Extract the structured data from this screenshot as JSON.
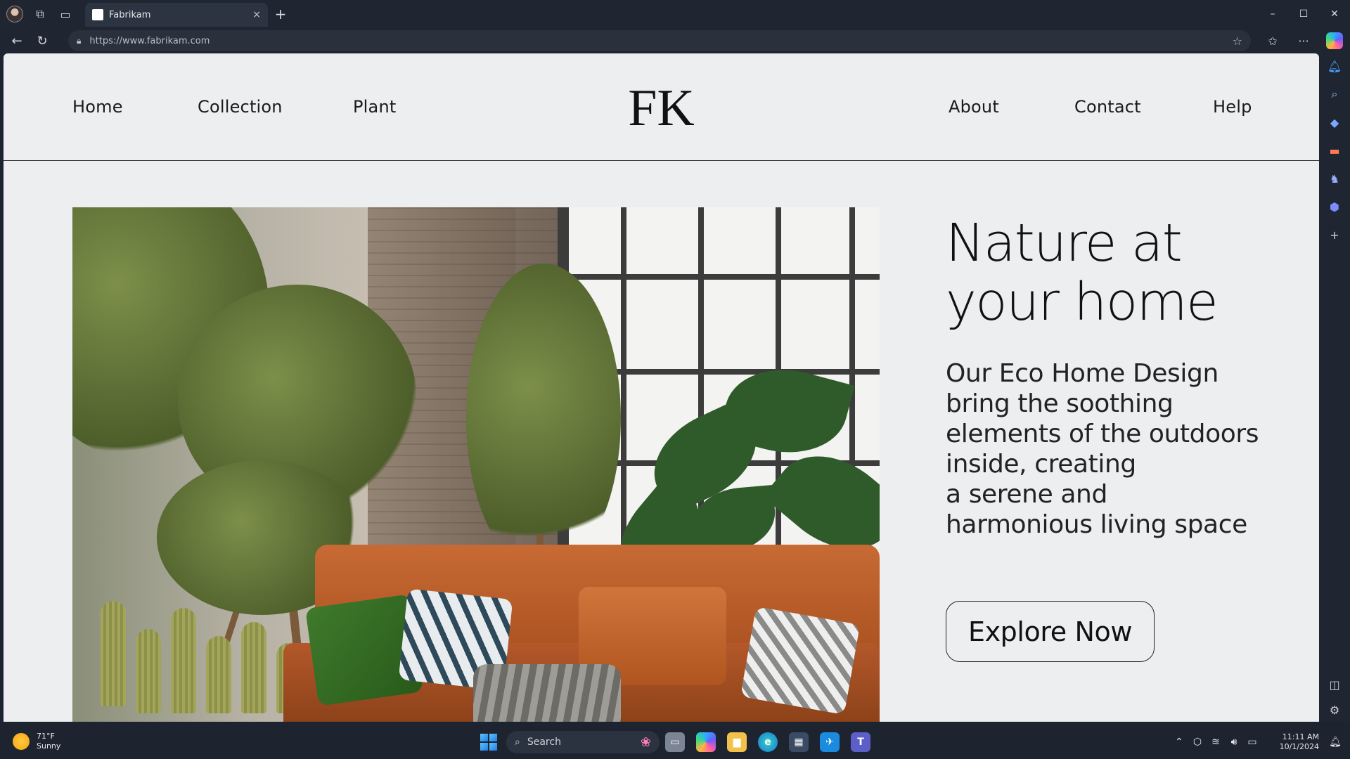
{
  "browser": {
    "tab": {
      "title": "Fabrikam",
      "close_glyph": "×"
    },
    "new_tab_glyph": "+",
    "address": {
      "url": "https://www.fabrikam.com"
    },
    "window_controls": {
      "minimize": "–",
      "maximize": "☐",
      "close": "✕"
    }
  },
  "site": {
    "nav_left": [
      "Home",
      "Collection",
      "Plant"
    ],
    "logo": "FK",
    "nav_right": [
      "About",
      "Contact",
      "Help"
    ],
    "hero": {
      "headline": "Nature at your home",
      "description": "Our Eco Home Design\nbring the soothing\nelements of the outdoors\ninside, creating\na serene and\nharmonious living space",
      "cta_label": "Explore Now"
    }
  },
  "taskbar": {
    "weather": {
      "temp": "71°F",
      "condition": "Sunny"
    },
    "search_placeholder": "Search",
    "clock": {
      "time": "11:11 AM",
      "date": "10/1/2024"
    }
  },
  "icons": {
    "titlebar": [
      "profile-avatar",
      "workspaces-icon",
      "tab-actions-icon"
    ],
    "toolbar": [
      "back-icon",
      "refresh-icon",
      "lock-icon",
      "add-favorite-icon",
      "favorites-icon",
      "more-icon",
      "copilot-icon"
    ],
    "sidebar": [
      "notifications-icon",
      "search-icon",
      "shopping-icon",
      "tools-icon",
      "games-icon",
      "office-icon",
      "add-icon",
      "split-screen-icon",
      "settings-icon"
    ],
    "taskbar": [
      "start-icon",
      "search-icon",
      "task-view-icon",
      "copilot-icon",
      "file-explorer-icon",
      "edge-icon",
      "store-icon",
      "outlook-icon",
      "teams-icon"
    ]
  },
  "colors": {
    "page_bg": "#edeeef",
    "chrome_bg": "#1f2632",
    "text": "#111111",
    "sofa": "#b3582a"
  }
}
